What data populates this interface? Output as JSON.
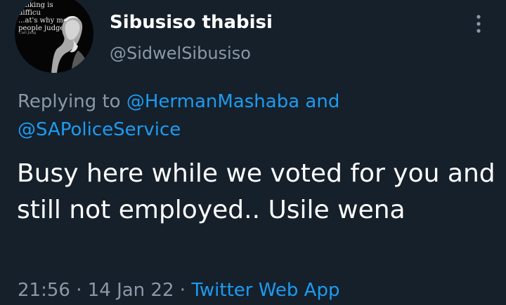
{
  "tweet": {
    "author": {
      "display_name": "Sibusiso thabisi",
      "handle": "@SidwelSibusiso",
      "avatar_quote": "...nking is difficu\n...at's why most\npeople judge.\"",
      "avatar_quote_author": "Carl Jung"
    },
    "reply": {
      "prefix": "Replying to",
      "mention_1": "@HermanMashaba",
      "conjunction": "and",
      "mention_2": "@SAPoliceService"
    },
    "text": "Busy here while we voted for you and still not employed.. Usile wena",
    "time": "21:56",
    "date": "14 Jan 22",
    "separator": "·",
    "source_app": "Twitter Web App"
  },
  "colors": {
    "background": "#15202b",
    "primary_text": "#ffffff",
    "secondary_text": "#8b98a5",
    "link": "#1d9bf0"
  },
  "icons": {
    "more": "more-vertical-icon"
  }
}
